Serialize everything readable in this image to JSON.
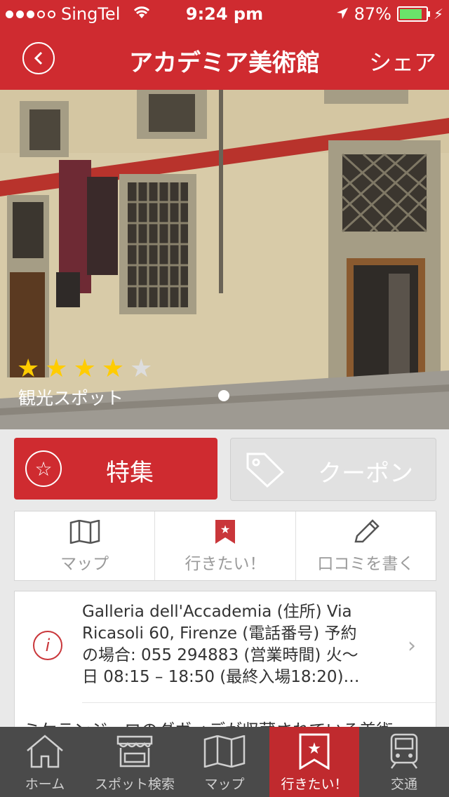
{
  "status": {
    "carrier": "SingTel",
    "time": "9:24 pm",
    "battery": "87%"
  },
  "nav": {
    "title": "アカデミア美術館",
    "share": "シェア",
    "back_icon": "back-icon"
  },
  "hero": {
    "stars": 4,
    "max_stars": 5,
    "category": "観光スポット"
  },
  "feature_button": {
    "label": "特集"
  },
  "coupon_button": {
    "label": "クーポン"
  },
  "actions": [
    {
      "label": "マップ",
      "icon": "map-icon"
    },
    {
      "label": "行きたい！",
      "icon": "bookmark-star-icon"
    },
    {
      "label": "口コミを書く",
      "icon": "pencil-icon"
    }
  ],
  "info": {
    "line1": "Galleria dell'Accademia  (住所) Via",
    "line2": "Ricasoli 60, Firenze  (電話番号) 予約",
    "line3": "の場合: 055 294883  (営業時間) 火〜",
    "line4": "日 08:15 – 18:50 (最終入場18:20)…",
    "description": "ミケランジェロのダヴィデが収蔵されている美術"
  },
  "tabs": [
    {
      "label": "ホーム",
      "icon": "home-icon"
    },
    {
      "label": "スポット検索",
      "icon": "shop-icon"
    },
    {
      "label": "マップ",
      "icon": "map-icon"
    },
    {
      "label": "行きたい！",
      "icon": "bookmark-star-icon",
      "active": true
    },
    {
      "label": "交通",
      "icon": "train-icon"
    }
  ]
}
